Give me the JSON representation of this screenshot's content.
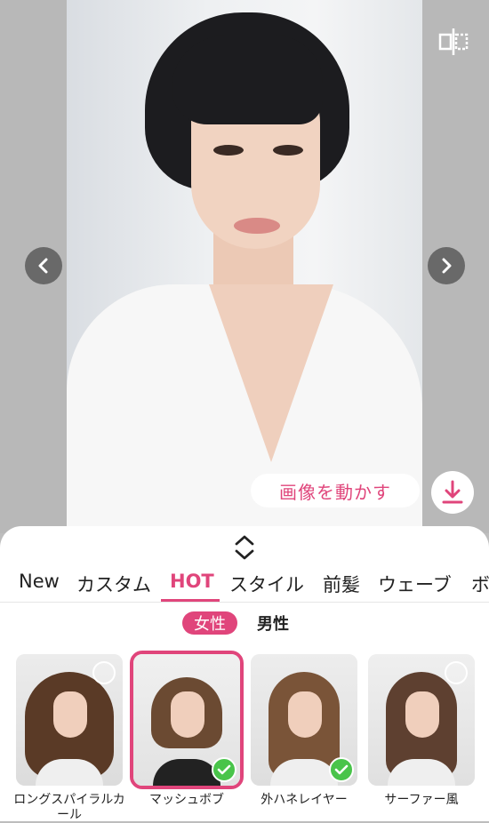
{
  "preview": {
    "move_button_label": "画像を動かす",
    "compare_icon": "compare-split-icon",
    "prev_icon": "chevron-left-icon",
    "next_icon": "chevron-right-icon",
    "download_icon": "download-icon"
  },
  "tabs": [
    {
      "label": "New"
    },
    {
      "label": "カスタム"
    },
    {
      "label": "HOT"
    },
    {
      "label": "スタイル"
    },
    {
      "label": "前髪"
    },
    {
      "label": "ウェーブ"
    },
    {
      "label": "ボ"
    }
  ],
  "active_tab": "HOT",
  "gender": {
    "female": "女性",
    "male": "男性",
    "selected": "女性"
  },
  "styles": [
    {
      "name": "ロングスパイラルカール",
      "selected": false,
      "checked": false,
      "hair_color": "#5a3a26"
    },
    {
      "name": "マッシュボブ",
      "selected": true,
      "checked": true,
      "hair_color": "#6b4a32"
    },
    {
      "name": "外ハネレイヤー",
      "selected": false,
      "checked": true,
      "hair_color": "#7a5438"
    },
    {
      "name": "サーファー風",
      "selected": false,
      "checked": false,
      "hair_color": "#5e4030"
    }
  ],
  "colors": {
    "accent": "#e0457b",
    "check": "#49c44a"
  }
}
